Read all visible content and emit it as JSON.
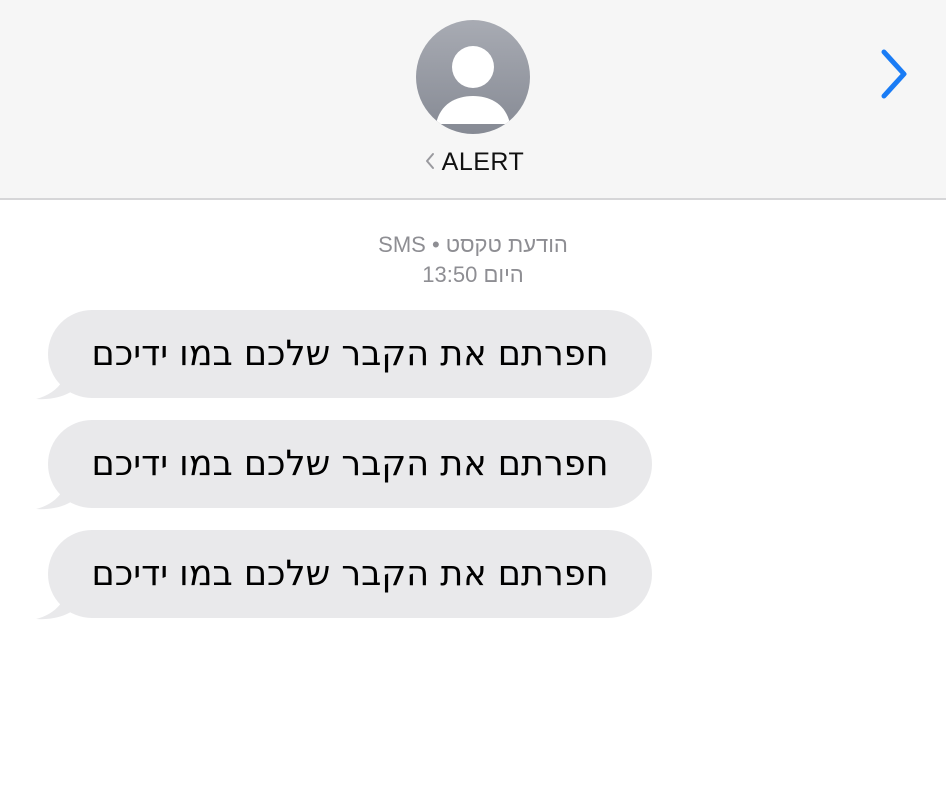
{
  "header": {
    "contact_name": "ALERT",
    "avatar_icon": "person-icon",
    "back_icon": "chevron-left-icon",
    "info_icon": "chevron-right-icon",
    "accent_color": "#1a7cf5"
  },
  "thread": {
    "service_label": "הודעת טקסט • SMS",
    "timestamp": "היום 13:50",
    "messages": [
      {
        "text": "חפרתם את הקבר שלכם במו ידיכם"
      },
      {
        "text": "חפרתם את הקבר שלכם במו ידיכם"
      },
      {
        "text": "חפרתם את הקבר שלכם במו ידיכם"
      }
    ]
  }
}
